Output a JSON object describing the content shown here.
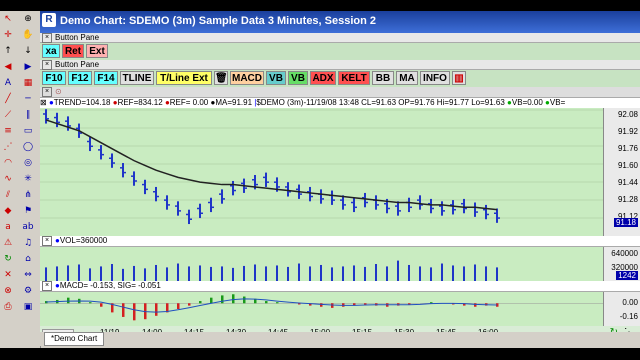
{
  "window": {
    "title": "Demo Chart: SDEMO (3m) Sample Data 3 Minutes, Session 2"
  },
  "button_pane": {
    "label": "Button Pane",
    "row1": [
      "xa",
      "Ret",
      "Ext"
    ],
    "row2": [
      "F10",
      "F12",
      "F14",
      "TLINE",
      "T/Line Ext",
      "MACD",
      "VB",
      "VB",
      "ADX",
      "KELT",
      "BB",
      "MA",
      "INFO"
    ],
    "colors": {
      "pink": "#ff6a6a",
      "green_bg": "#c7e3c2",
      "yellow": "#ffff66",
      "cyan": "#66ffff"
    }
  },
  "info_bar": {
    "trend": "TREND=104.18",
    "ref1": "REF=834.12",
    "ref2": "REF= 0.00",
    "ma": "MA=91.91",
    "quote": "$DEMO (3m)-11/19/08 13:48 CL=91.63 OP=91.76 Hi=91.77 Lo=91.63",
    "vb": "VB=0.00",
    "vb2": "VB="
  },
  "price_axis": {
    "ticks": [
      "92.08",
      "91.92",
      "91.76",
      "91.60",
      "91.44",
      "91.28",
      "91.12"
    ],
    "last": "91.18"
  },
  "volume_pane": {
    "label": "VOL=360000",
    "ticks": [
      "640000",
      "320000"
    ],
    "last": "1242"
  },
  "macd_pane": {
    "label": "MACD= -0.153, SIG= -0.051",
    "ticks": [
      "0.00",
      "-0.16"
    ]
  },
  "time_axis": {
    "ticks": [
      "11/19",
      "14:00",
      "14:15",
      "14:30",
      "14:45",
      "15:00",
      "15:15",
      "15:30",
      "15:45",
      "16:00"
    ]
  },
  "tabs": {
    "active": "*Demo Chart"
  },
  "chart_data": [
    {
      "type": "bar",
      "title": "",
      "series": [
        {
          "name": "SDEMO (3m)",
          "values": [
            92.05,
            92.02,
            91.99,
            91.93,
            91.82,
            91.75,
            91.68,
            91.6,
            91.53,
            91.46,
            91.4,
            91.33,
            91.28,
            91.21,
            91.26,
            91.31,
            91.38,
            91.45,
            91.47,
            91.5,
            91.52,
            91.48,
            91.44,
            91.42,
            91.4,
            91.38,
            91.37,
            91.33,
            91.31,
            91.35,
            91.33,
            91.3,
            91.28,
            91.31,
            91.33,
            91.3,
            91.28,
            91.29,
            91.3,
            91.27,
            91.25,
            91.22
          ]
        }
      ],
      "ma": [
        92.02,
        91.99,
        91.96,
        91.93,
        91.88,
        91.83,
        91.78,
        91.73,
        91.68,
        91.64,
        91.6,
        91.57,
        91.54,
        91.52,
        91.5,
        91.49,
        91.48,
        91.48,
        91.47,
        91.46,
        91.45,
        91.44,
        91.43,
        91.42,
        91.41,
        91.4,
        91.39,
        91.38,
        91.37,
        91.36,
        91.35,
        91.34,
        91.33,
        91.33,
        91.32,
        91.31,
        91.31,
        91.3,
        91.29,
        91.29,
        91.28,
        91.27
      ],
      "ylim": [
        91.05,
        92.12
      ]
    },
    {
      "type": "bar",
      "series": [
        {
          "name": "VOL",
          "values": [
            280000,
            300000,
            320000,
            340000,
            260000,
            300000,
            350000,
            250000,
            310000,
            260000,
            330000,
            280000,
            360000,
            300000,
            320000,
            290000,
            300000,
            270000,
            310000,
            340000,
            300000,
            320000,
            290000,
            360000,
            300000,
            330000,
            280000,
            300000,
            320000,
            290000,
            350000,
            300000,
            420000,
            330000,
            300000,
            280000,
            360000,
            320000,
            300000,
            340000,
            300000,
            280000
          ]
        }
      ],
      "ylim": [
        0,
        700000
      ]
    },
    {
      "type": "bar",
      "series": [
        {
          "name": "MACD",
          "values": [
            0.02,
            0.03,
            0.05,
            0.04,
            0.01,
            -0.03,
            -0.08,
            -0.12,
            -0.15,
            -0.14,
            -0.11,
            -0.08,
            -0.05,
            -0.02,
            0.02,
            0.05,
            0.07,
            0.08,
            0.06,
            0.04,
            0.02,
            0.01,
            0.0,
            -0.01,
            -0.02,
            -0.03,
            -0.04,
            -0.03,
            -0.02,
            -0.01,
            -0.02,
            -0.03,
            -0.02,
            -0.01,
            0.0,
            0.01,
            0.0,
            -0.01,
            -0.02,
            -0.03,
            -0.02,
            -0.03
          ]
        }
      ],
      "ylim": [
        -0.2,
        0.1
      ]
    }
  ]
}
